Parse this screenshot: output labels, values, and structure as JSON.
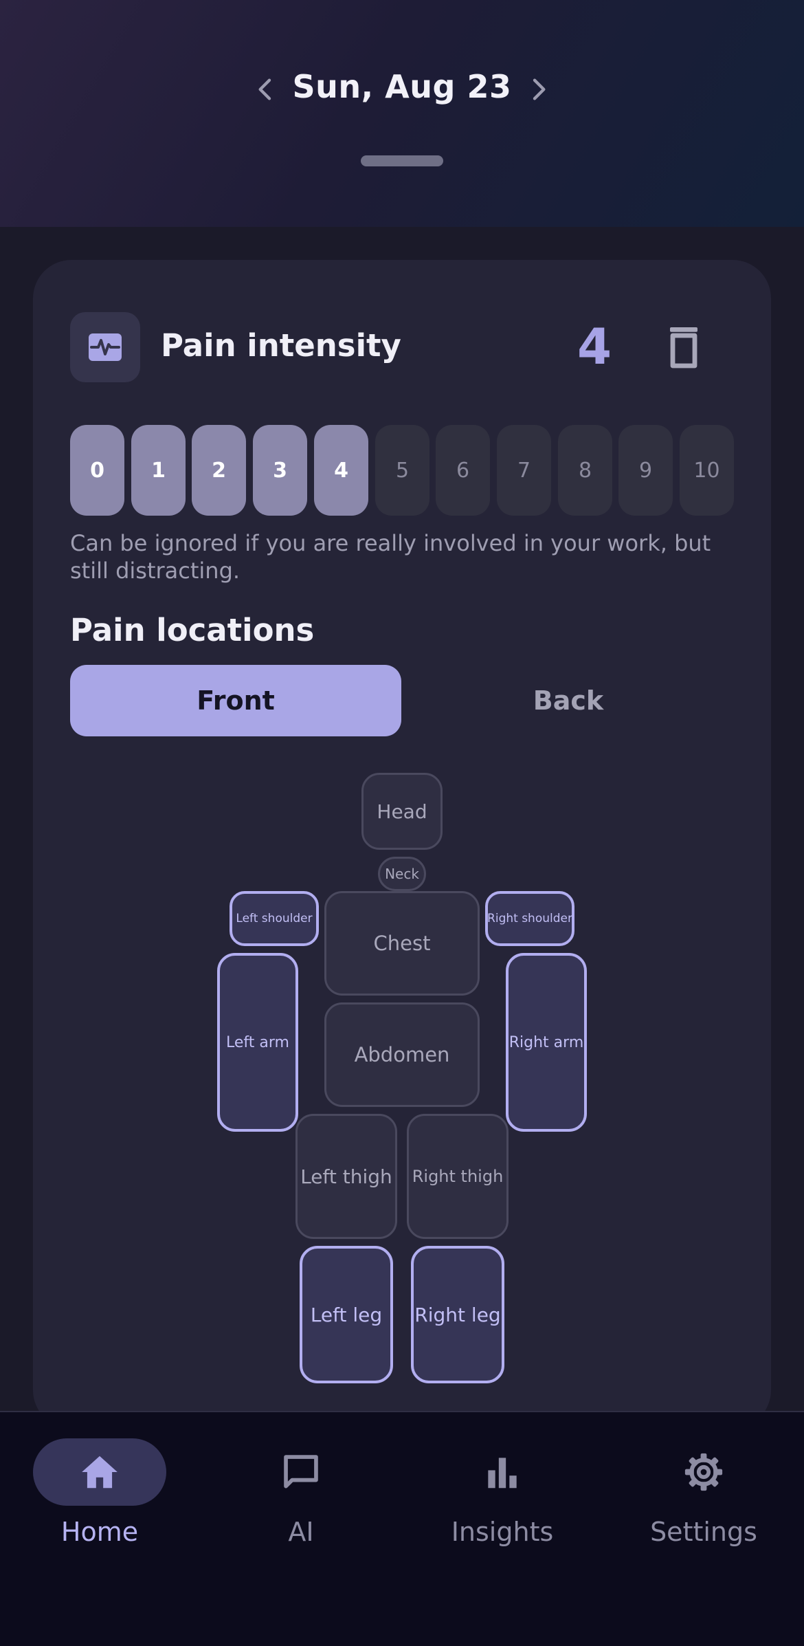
{
  "header": {
    "date": "Sun, Aug 23"
  },
  "pain_intensity": {
    "title": "Pain intensity",
    "value": "4",
    "scale": [
      "0",
      "1",
      "2",
      "3",
      "4",
      "5",
      "6",
      "7",
      "8",
      "9",
      "10"
    ],
    "selected": 4,
    "description": "Can be ignored if you are really involved in your work, but still distracting."
  },
  "pain_locations": {
    "title": "Pain locations",
    "tabs": {
      "front": "Front",
      "back": "Back"
    },
    "active_tab": "Front",
    "parts": {
      "head": "Head",
      "neck": "Neck",
      "left_shoulder": "Left shoulder",
      "right_shoulder": "Right shoulder",
      "chest": "Chest",
      "left_arm": "Left arm",
      "right_arm": "Right arm",
      "abdomen": "Abdomen",
      "left_thigh": "Left thigh",
      "right_thigh": "Right thigh",
      "left_leg": "Left leg",
      "right_leg": "Right leg"
    },
    "selected_parts": [
      "Left shoulder",
      "Right shoulder",
      "Left arm",
      "Right arm",
      "Left leg",
      "Right leg"
    ]
  },
  "bottom_nav": {
    "items": [
      {
        "label": "Home",
        "icon": "home-icon",
        "active": true
      },
      {
        "label": "AI",
        "icon": "chat-icon",
        "active": false
      },
      {
        "label": "Insights",
        "icon": "bar-chart-icon",
        "active": false
      },
      {
        "label": "Settings",
        "icon": "gear-icon",
        "active": false
      }
    ]
  },
  "colors": {
    "accent": "#a9a6e6",
    "background": "#1b1a29",
    "card": "#252437"
  }
}
